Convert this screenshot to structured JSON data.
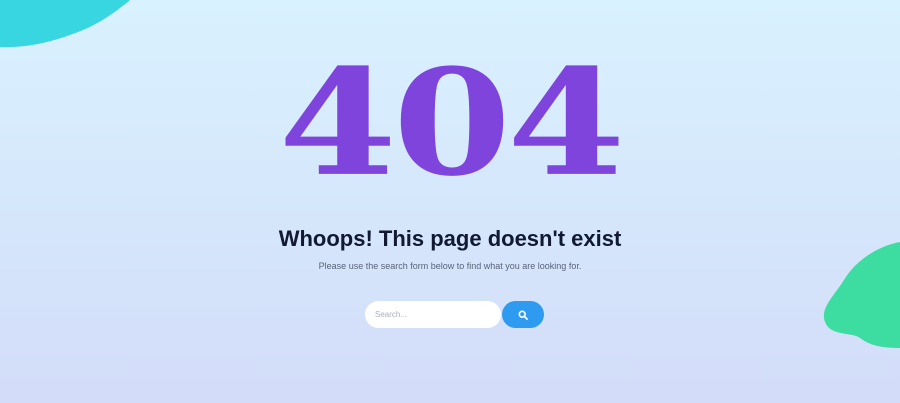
{
  "colors": {
    "accent_purple": "#7e44dc",
    "search_button": "#2f9bf0",
    "blob_cyan": "#38d6e0",
    "blob_green": "#3ddca0",
    "heading": "#121a33"
  },
  "hero": {
    "code": "404"
  },
  "message": {
    "title": "Whoops! This page doesn't exist",
    "subtitle": "Please use the search form below to find what you are looking for."
  },
  "search": {
    "placeholder": "Search...",
    "value": "",
    "button_icon": "search-icon"
  }
}
